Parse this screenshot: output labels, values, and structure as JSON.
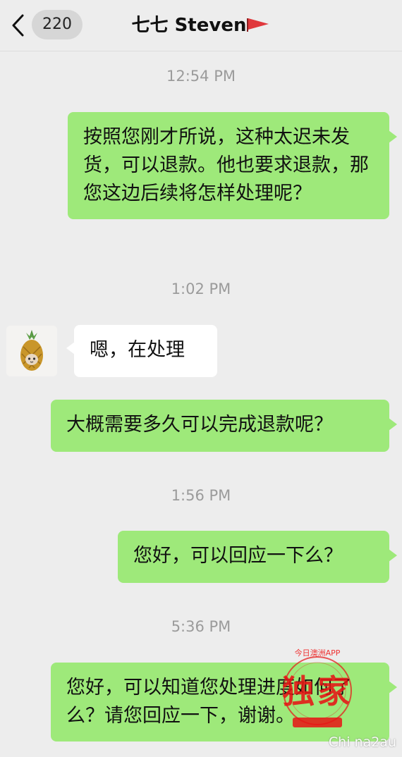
{
  "header": {
    "unread_count": "220",
    "title": "七七 Steven"
  },
  "messages": [
    {
      "type": "time",
      "text": "12:54 PM"
    },
    {
      "type": "outgoing",
      "text": "按照您刚才所说，这种太迟未发货，可以退款。他也要求退款，那您这边后续将怎样处理呢？"
    },
    {
      "type": "time",
      "text": "1:02 PM"
    },
    {
      "type": "incoming",
      "text": "嗯，在处理"
    },
    {
      "type": "outgoing",
      "text": "大概需要多久可以完成退款呢？"
    },
    {
      "type": "time",
      "text": "1:56 PM"
    },
    {
      "type": "outgoing",
      "text": "您好，可以回应一下么？"
    },
    {
      "type": "time",
      "text": "5:36 PM"
    },
    {
      "type": "outgoing",
      "text": "您好，可以知道您处理进度如何了么？请您回应一下，谢谢。"
    }
  ],
  "watermark": {
    "ring_text": "今日澳洲APP",
    "main_text": "独家",
    "corner_text": "Chi na2au"
  },
  "colors": {
    "outgoing_bubble": "#9ee97a",
    "incoming_bubble": "#ffffff",
    "background": "#ededed",
    "flag": "#e0383c"
  }
}
